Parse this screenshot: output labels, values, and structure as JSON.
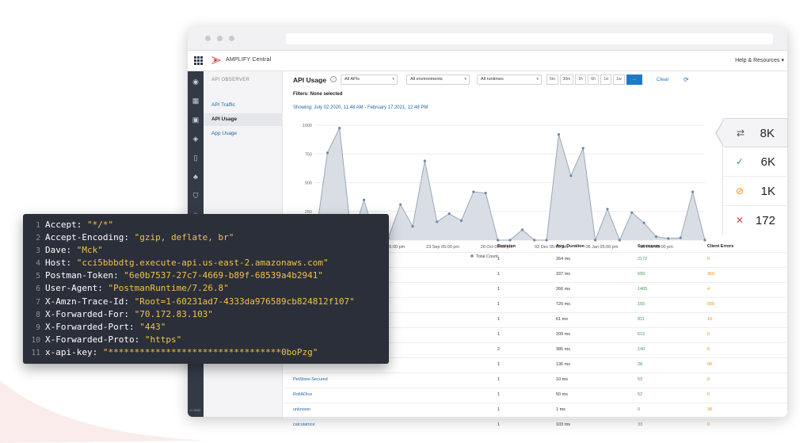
{
  "window": {
    "app_name": "AMPLIFY Central",
    "help_label": "Help & Resources",
    "version": "v1.3550"
  },
  "sidebar": {
    "heading": "API OBSERVER",
    "items": [
      {
        "label": "API Traffic"
      },
      {
        "label": "API Usage"
      },
      {
        "label": "App Usage"
      }
    ]
  },
  "main": {
    "title": "API Usage",
    "filters": {
      "apis": "All APIs",
      "environments": "All environments",
      "runtimes": "All runtimes"
    },
    "time_buttons": [
      "5m",
      "30m",
      "1h",
      "6h",
      "1d",
      "1w",
      "..."
    ],
    "clear_label": "Clear",
    "filters_text": "Filters: None selected",
    "showing_text": "Showing: July 02 2020, 11:48 AM - February 17 2021, 12:48 PM"
  },
  "chart_data": {
    "type": "area",
    "series": [
      {
        "name": "Total Count",
        "values": [
          0,
          760,
          975,
          0,
          350,
          0,
          20,
          310,
          120,
          690,
          160,
          230,
          170,
          420,
          410,
          0,
          0,
          90,
          0,
          0,
          920,
          560,
          800,
          0,
          270,
          0,
          240,
          150,
          30,
          15,
          20,
          420,
          0
        ]
      }
    ],
    "y_ticks": [
      "0",
      "250",
      "500",
      "750",
      "1000"
    ],
    "x_ticks": [
      "9 Aug 05:00 pm",
      "23 Sep 05:00 pm",
      "28 Oct 05:00 pm",
      "02 Dec 05:00 pm",
      "06 Jan 05:00 pm",
      "10 Feb 05:00 pm"
    ],
    "ylim": [
      0,
      1000
    ],
    "legend": "Total Count",
    "legend_position": "bottom",
    "colors": {
      "fill": "#d9dee5",
      "line": "#9aa7b7",
      "point": "#6f88a8"
    }
  },
  "stats": [
    {
      "icon": "arrows-icon",
      "glyph": "⇄",
      "value": "8K",
      "color": "#555555"
    },
    {
      "icon": "check-icon",
      "glyph": "✓",
      "value": "6K",
      "color": "#3d9a52"
    },
    {
      "icon": "blocked-icon",
      "glyph": "⊘",
      "value": "1K",
      "color": "#f08a1c"
    },
    {
      "icon": "x-icon",
      "glyph": "✕",
      "value": "172",
      "color": "#e0443a"
    }
  ],
  "table": {
    "headers": {
      "revision": "Revision",
      "duration": "Avg. Duration",
      "successes": "Successes",
      "client_errors": "Client Errors"
    },
    "rows": [
      {
        "name": "",
        "revision": "1",
        "duration": "264 ms",
        "successes": "2172",
        "errors": "0"
      },
      {
        "name": "",
        "revision": "1",
        "duration": "337 ms",
        "successes": "699",
        "errors": "950"
      },
      {
        "name": "",
        "revision": "1",
        "duration": "266 ms",
        "successes": "1465",
        "errors": "4"
      },
      {
        "name": "",
        "revision": "1",
        "duration": "720 ms",
        "successes": "155",
        "errors": "656"
      },
      {
        "name": "",
        "revision": "1",
        "duration": "61 ms",
        "successes": "811",
        "errors": "16"
      },
      {
        "name": "",
        "revision": "1",
        "duration": "209 ms",
        "successes": "612",
        "errors": "0"
      },
      {
        "name": "",
        "revision": "2",
        "duration": "385 ms",
        "successes": "140",
        "errors": "6"
      },
      {
        "name": "",
        "revision": "1",
        "duration": "136 ms",
        "successes": "28",
        "errors": "90"
      },
      {
        "name": "PetStore-Secured",
        "revision": "1",
        "duration": "10 ms",
        "successes": "53",
        "errors": "0"
      },
      {
        "name": "RollADice",
        "revision": "1",
        "duration": "50 ms",
        "successes": "52",
        "errors": "0"
      },
      {
        "name": "unknown",
        "revision": "1",
        "duration": "1 ms",
        "successes": "0",
        "errors": "38"
      },
      {
        "name": "calculatrice",
        "revision": "1",
        "duration": "103 ms",
        "successes": "33",
        "errors": "0"
      }
    ]
  },
  "code": {
    "lines": [
      {
        "num": "1",
        "key": "Accept: ",
        "value": "\"*/*\""
      },
      {
        "num": "2",
        "key": "Accept-Encoding: ",
        "value": "\"gzip, deflate, br\""
      },
      {
        "num": "3",
        "key": "Dave: ",
        "value": "\"Mck\""
      },
      {
        "num": "4",
        "key": "Host: ",
        "value": "\"cci5bbbdtg.execute-api.us-east-2.amazonaws.com\""
      },
      {
        "num": "5",
        "key": "Postman-Token: ",
        "value": "\"6e0b7537-27c7-4669-b89f-68539a4b2941\""
      },
      {
        "num": "6",
        "key": "User-Agent: ",
        "value": "\"PostmanRuntime/7.26.8\""
      },
      {
        "num": "7",
        "key": "X-Amzn-Trace-Id: ",
        "value": "\"Root=1-60231ad7-4333da976589cb824812f107\""
      },
      {
        "num": "8",
        "key": "X-Forwarded-For: ",
        "value": "\"70.172.83.103\""
      },
      {
        "num": "9",
        "key": "X-Forwarded-Port: ",
        "value": "\"443\""
      },
      {
        "num": "10",
        "key": "X-Forwarded-Proto: ",
        "value": "\"https\""
      },
      {
        "num": "11",
        "key": "x-api-key: ",
        "value": "\"*********************************0boPzg\""
      }
    ]
  }
}
